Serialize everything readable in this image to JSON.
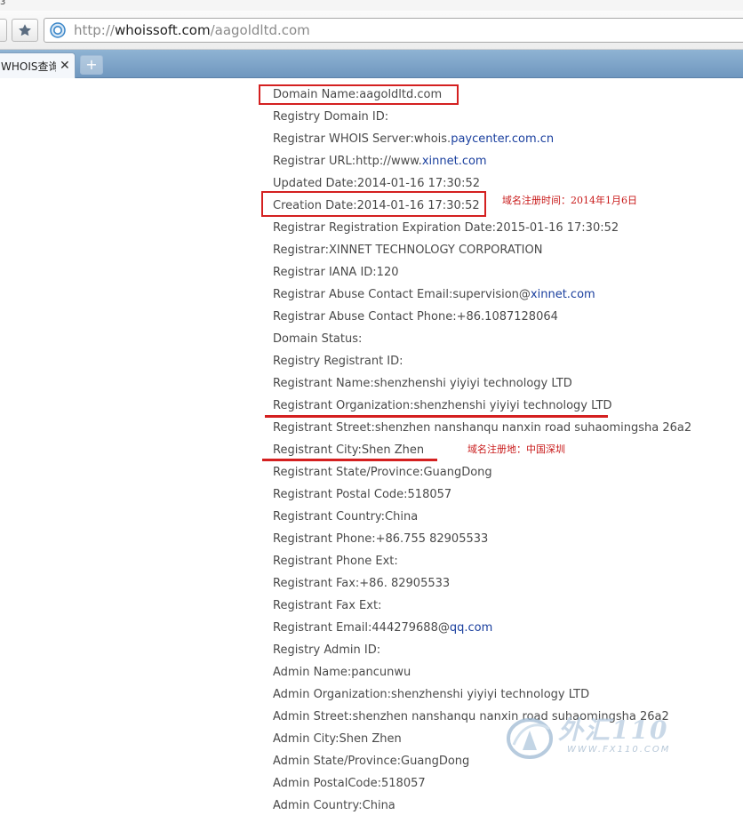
{
  "window": {
    "corner_text": "3"
  },
  "address_bar": {
    "prefix": "http://",
    "host": "whoissoft.com",
    "path": "/aagoldltd.com"
  },
  "tab": {
    "title": "WHOIS查询",
    "close_glyph": "✕",
    "new_tab_glyph": "+"
  },
  "whois": {
    "lines": [
      {
        "text": "Domain Name:aagoldltd.com"
      },
      {
        "text": "Registry Domain ID:"
      },
      {
        "text": "Registrar WHOIS Server:whois.",
        "link": "paycenter.com.cn"
      },
      {
        "text": "Registrar URL:http://www.",
        "link": "xinnet.com"
      },
      {
        "text": "Updated Date:2014-01-16 17:30:52"
      },
      {
        "text": "Creation Date:2014-01-16 17:30:52"
      },
      {
        "text": "Registrar Registration Expiration Date:2015-01-16 17:30:52"
      },
      {
        "text": "Registrar:XINNET TECHNOLOGY CORPORATION"
      },
      {
        "text": "Registrar IANA ID:120"
      },
      {
        "text": "Registrar Abuse Contact Email:supervision@",
        "link": "xinnet.com"
      },
      {
        "text": "Registrar Abuse Contact Phone:+86.1087128064"
      },
      {
        "text": "Domain Status:"
      },
      {
        "text": "Registry Registrant ID:"
      },
      {
        "text": "Registrant Name:shenzhenshi yiyiyi technology LTD"
      },
      {
        "text": "Registrant Organization:shenzhenshi yiyiyi technology LTD"
      },
      {
        "text": "Registrant Street:shenzhen nanshanqu nanxin road suhaomingsha 26a2"
      },
      {
        "text": "Registrant City:Shen Zhen"
      },
      {
        "text": "Registrant State/Province:GuangDong"
      },
      {
        "text": "Registrant Postal Code:518057"
      },
      {
        "text": "Registrant Country:China"
      },
      {
        "text": "Registrant Phone:+86.755 82905533"
      },
      {
        "text": "Registrant Phone Ext:"
      },
      {
        "text": "Registrant Fax:+86. 82905533"
      },
      {
        "text": "Registrant Fax Ext:"
      },
      {
        "text": "Registrant Email:444279688@",
        "link": "qq.com"
      },
      {
        "text": "Registry Admin ID:"
      },
      {
        "text": "Admin Name:pancunwu"
      },
      {
        "text": "Admin Organization:shenzhenshi yiyiyi technology LTD"
      },
      {
        "text": "Admin Street:shenzhen nanshanqu nanxin road suhaomingsha 26a2"
      },
      {
        "text": "Admin City:Shen Zhen"
      },
      {
        "text": "Admin State/Province:GuangDong"
      },
      {
        "text": "Admin PostalCode:518057"
      },
      {
        "text": "Admin Country:China"
      }
    ]
  },
  "annotations": {
    "creation_note": "域名注册时间：2014年1月6日",
    "location_note": "域名注册地：中国深圳",
    "highlight_color": "#d42020"
  },
  "watermark": {
    "brand": "外汇110",
    "site": "WWW.FX110.COM"
  }
}
